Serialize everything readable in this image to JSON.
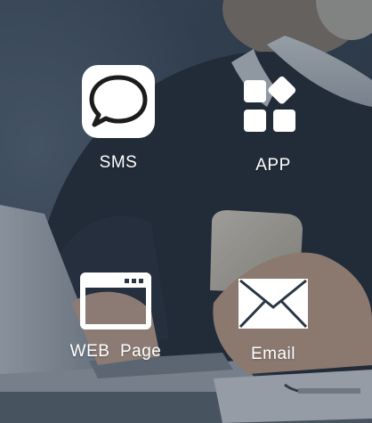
{
  "tiles": {
    "sms": {
      "label": "SMS",
      "icon": "chat-bubble-icon"
    },
    "app": {
      "label": "APP",
      "icon": "app-grid-icon"
    },
    "web": {
      "label": "WEB  Page",
      "icon": "browser-window-icon"
    },
    "email": {
      "label": "Email",
      "icon": "envelope-icon"
    }
  },
  "colors": {
    "icon": "#ffffff",
    "label": "#ffffff",
    "overlay": "#283444"
  }
}
